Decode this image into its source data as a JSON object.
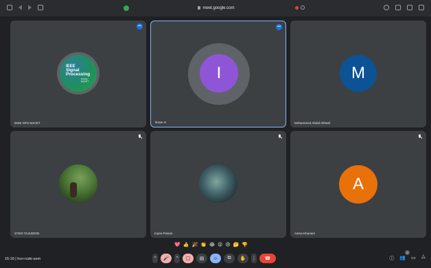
{
  "browser": {
    "url": "meet.google.com"
  },
  "tiles": [
    {
      "name": "IEEE SPS MJCET",
      "logo_lines": [
        "IEEE",
        "Signal",
        "Processing",
        "Society",
        "MJCET"
      ]
    },
    {
      "name": "Ikram H",
      "initial": "I"
    },
    {
      "name": "Mohammed Abdul Akheel",
      "initial": "M"
    },
    {
      "name": "SYED TAJUDDIN"
    },
    {
      "name": "Inyee Poison"
    },
    {
      "name": "Asma Khanam",
      "initial": "A"
    }
  ],
  "reactions": [
    "💖",
    "👍",
    "🎉",
    "👏",
    "😂",
    "😮",
    "😢",
    "🤔",
    "👎"
  ],
  "meeting": {
    "time": "15:16",
    "code": "hcn-rudx-uom"
  },
  "participant_count": "6",
  "colors": {
    "accent": "#8ab4f8",
    "end_call": "#ea4335",
    "avatar_i": "#8e56d6",
    "avatar_m": "#0b5394",
    "avatar_a": "#e8710a"
  }
}
